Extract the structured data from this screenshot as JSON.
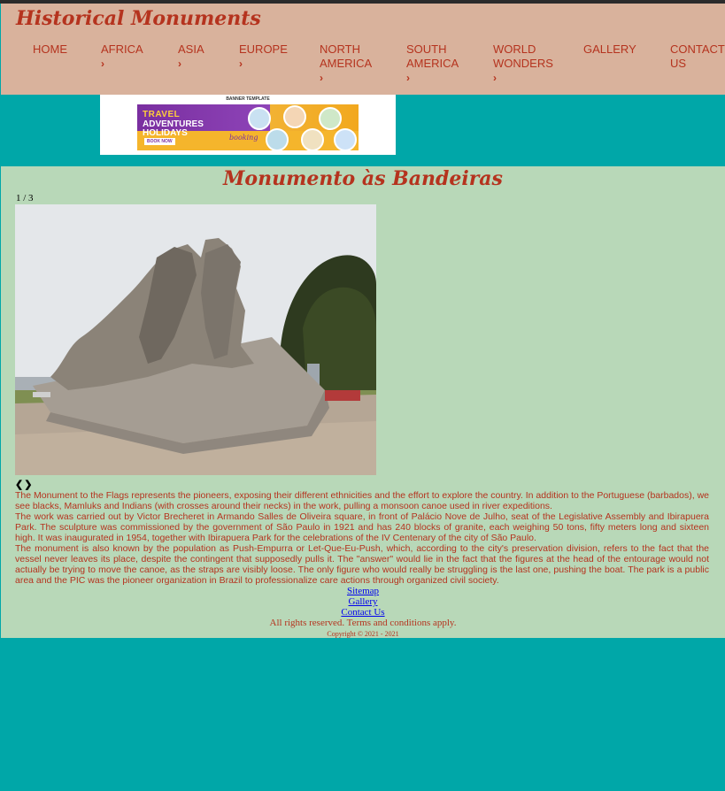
{
  "site_title": "Historical Monuments",
  "nav": [
    {
      "label": "HOME",
      "has_dropdown": false
    },
    {
      "label": "AFRICA",
      "has_dropdown": true
    },
    {
      "label": "ASIA",
      "has_dropdown": true
    },
    {
      "label": "EUROPE",
      "has_dropdown": true
    },
    {
      "label": "NORTH AMERICA",
      "has_dropdown": true
    },
    {
      "label": "SOUTH AMERICA",
      "has_dropdown": true
    },
    {
      "label": "WORLD WONDERS",
      "has_dropdown": true
    },
    {
      "label": "GALLERY",
      "has_dropdown": false
    },
    {
      "label": "CONTACT US",
      "has_dropdown": false
    }
  ],
  "banner": {
    "caption": "BANNER TEMPLATE",
    "headline_1": "TRAVEL",
    "headline_2": "ADVENTURES",
    "headline_3": "HOLIDAYS",
    "button": "BOOK NOW",
    "brand": "booking"
  },
  "page": {
    "heading": "Monumento às Bandeiras",
    "slide_counter": "1 / 3",
    "prev_arrow": "❮",
    "next_arrow": "❯",
    "paragraphs": [
      "The Monument to the Flags represents the pioneers, exposing their different ethnicities and the effort to explore the country. In addition to the Portuguese (barbados), we see blacks, Mamluks and Indians (with crosses around their necks) in the work, pulling a monsoon canoe used in river expeditions.",
      "The work was carried out by Victor Brecheret in Armando Salles de Oliveira square, in front of Palácio Nove de Julho, seat of the Legislative Assembly and Ibirapuera Park. The sculpture was commissioned by the government of São Paulo in 1921 and has 240 blocks of granite, each weighing 50 tons, fifty meters long and sixteen high. It was inaugurated in 1954, together with Ibirapuera Park for the celebrations of the IV Centenary of the city of São Paulo.",
      "The monument is also known by the population as Push-Empurra or Let-Que-Eu-Push, which, according to the city's preservation division, refers to the fact that the vessel never leaves its place, despite the contingent that supposedly pulls it. The \"answer\" would lie in the fact that the figures at the head of the entourage would not actually be trying to move the canoe, as the straps are visibly loose. The only figure who would really be struggling is the last one, pushing the boat. The park is a public area and the PIC was the pioneer organization in Brazil to professionalize care actions through organized civil society."
    ]
  },
  "footer": {
    "links": [
      "Sitemap",
      "Gallery",
      "Contact Us"
    ],
    "rights": "All rights reserved. Terms and conditions apply.",
    "copyright": "Copyright © 2021 - 2021"
  },
  "colors": {
    "accent_red": "#b5331e",
    "header_bg": "#d9b29c",
    "teal_bg": "#00a7a8",
    "content_bg": "#b8d8b8",
    "link_blue": "#0000ee"
  }
}
